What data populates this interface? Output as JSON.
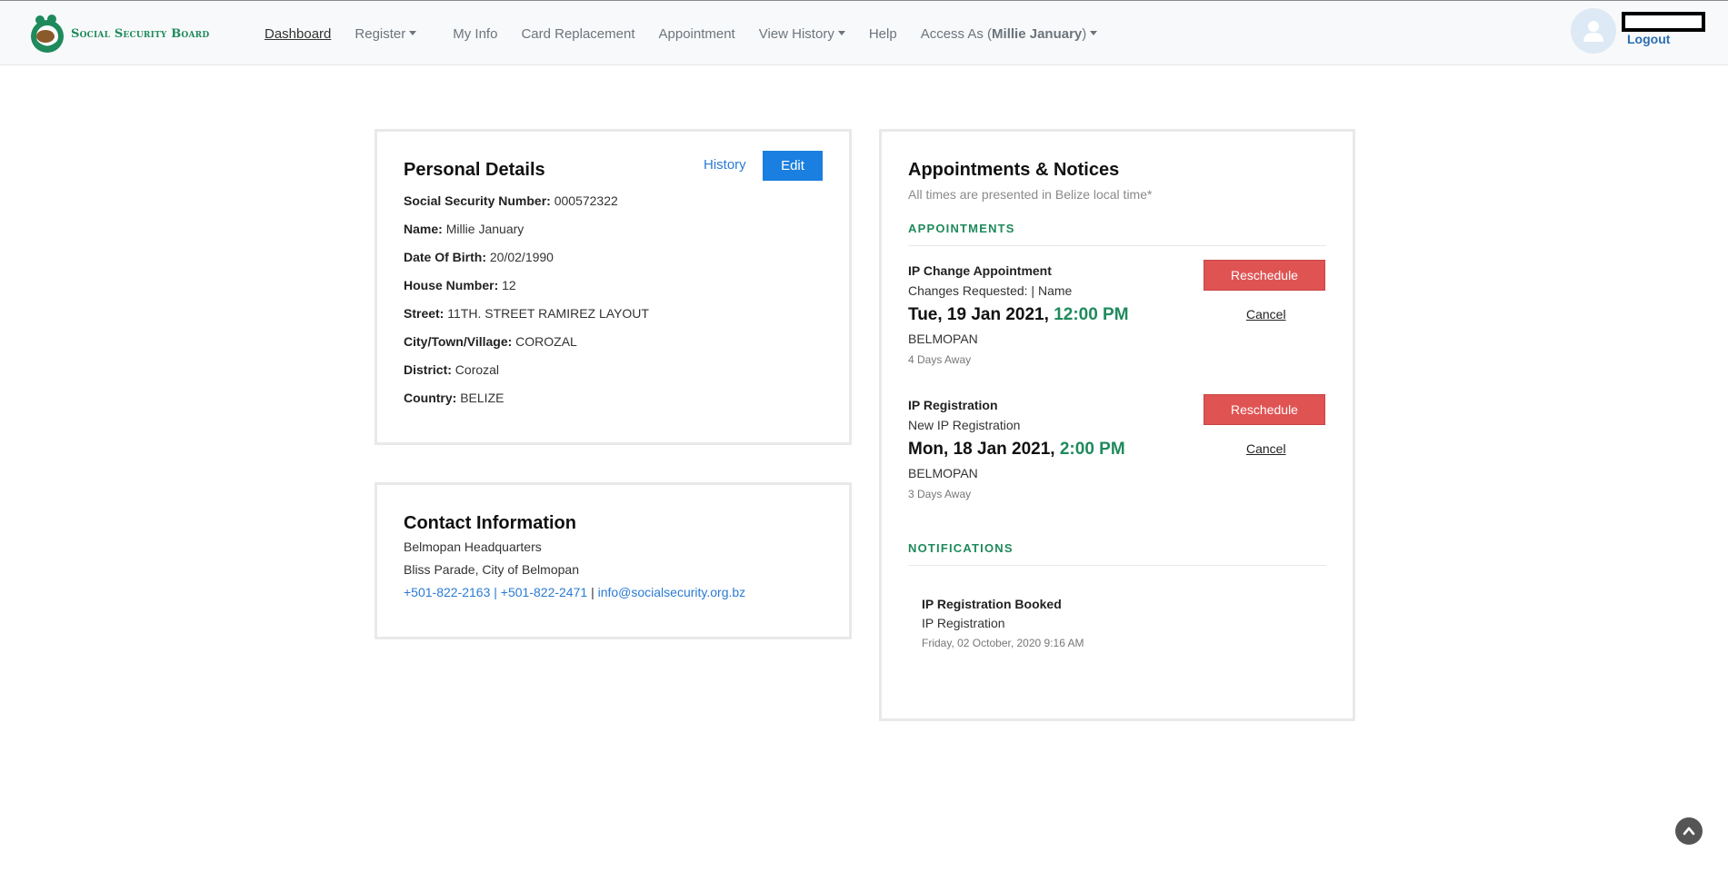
{
  "brand": {
    "name": "Social Security Board"
  },
  "nav": {
    "dashboard": "Dashboard",
    "register": "Register",
    "my_info": "My Info",
    "card_replacement": "Card Replacement",
    "appointment": "Appointment",
    "view_history": "View History",
    "help": "Help",
    "access_as_prefix": "Access As (",
    "access_as_name": "Millie January",
    "access_as_suffix": ")"
  },
  "user": {
    "logout": "Logout"
  },
  "personal": {
    "title": "Personal Details",
    "history_label": "History",
    "edit_label": "Edit",
    "rows": [
      {
        "label": "Social Security Number:",
        "value": "000572322"
      },
      {
        "label": "Name:",
        "value": "Millie January"
      },
      {
        "label": "Date Of Birth:",
        "value": "20/02/1990"
      },
      {
        "label": "House Number:",
        "value": "12"
      },
      {
        "label": "Street:",
        "value": "11TH. STREET RAMIREZ LAYOUT"
      },
      {
        "label": "City/Town/Village:",
        "value": "COROZAL"
      },
      {
        "label": "District:",
        "value": "Corozal"
      },
      {
        "label": "Country:",
        "value": "BELIZE"
      }
    ]
  },
  "contact": {
    "title": "Contact Information",
    "office": "Belmopan Headquarters",
    "address": "Bliss Parade, City of Belmopan",
    "phone1": "+501-822-2163",
    "phone2": "+501-822-2471",
    "separator": "|",
    "email": "info@socialsecurity.org.bz"
  },
  "appointments": {
    "title": "Appointments & Notices",
    "subtitle": "All times are presented in Belize local time*",
    "section_label": "APPOINTMENTS",
    "reschedule_label": "Reschedule",
    "cancel_label": "Cancel",
    "items": [
      {
        "title": "IP Change Appointment",
        "desc": "Changes Requested: | Name",
        "date": "Tue, 19 Jan 2021,",
        "time": "12:00 PM",
        "location": "BELMOPAN",
        "away": "4 Days Away"
      },
      {
        "title": "IP Registration",
        "desc": "New IP Registration",
        "date": "Mon, 18 Jan 2021,",
        "time": "2:00 PM",
        "location": "BELMOPAN",
        "away": "3 Days Away"
      }
    ]
  },
  "notifications": {
    "section_label": "NOTIFICATIONS",
    "items": [
      {
        "title": "IP Registration Booked",
        "desc": "IP Registration",
        "time": "Friday, 02 October, 2020 9:16 AM"
      }
    ]
  },
  "colors": {
    "brand_green": "#1f8a5c",
    "primary_blue": "#1a7fe0",
    "danger_red": "#e05353",
    "link_blue": "#2a7bd3"
  },
  "icons": {
    "logo": "ssb-logo-icon",
    "avatar": "user-icon",
    "scroll_top": "chevron-up-icon",
    "dropdown": "caret-down-icon"
  }
}
